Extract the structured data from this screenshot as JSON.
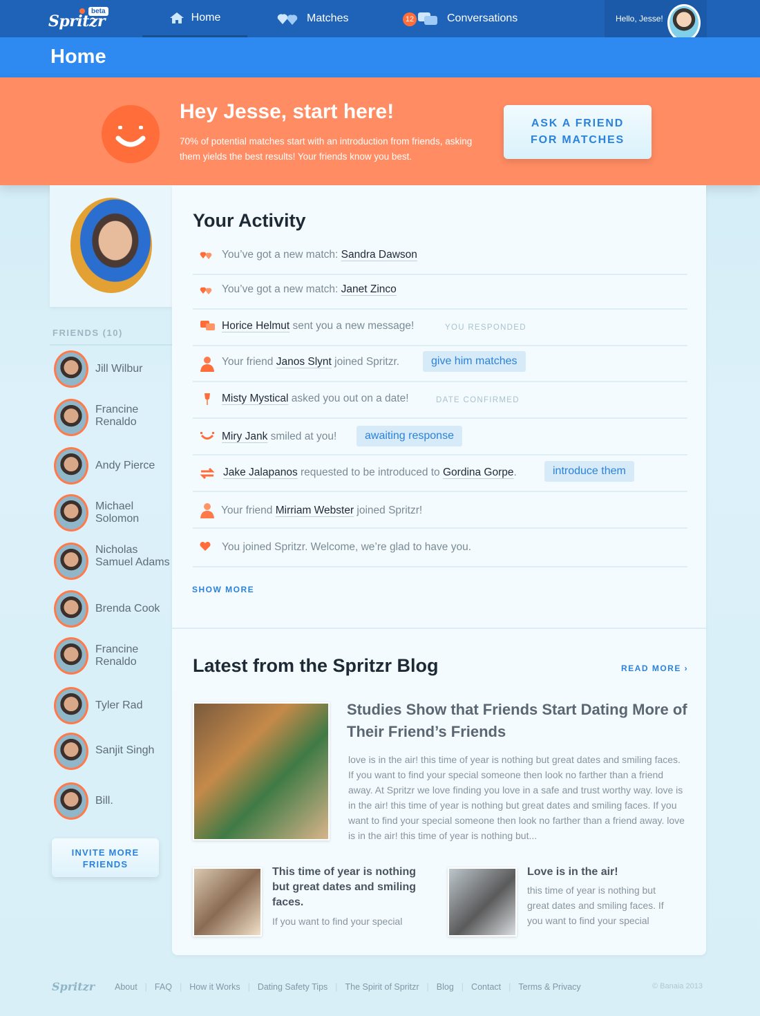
{
  "nav": {
    "logo": "Spritzr",
    "beta": "beta",
    "home": "Home",
    "matches": "Matches",
    "conversations": "Conversations",
    "conversation_count": "12",
    "greeting": "Hello, Jesse!"
  },
  "page_title": "Home",
  "hero": {
    "title": "Hey Jesse, start here!",
    "text": "70% of potential matches start with an introduction from friends, asking them yields the best results! Your friends know you best.",
    "button": "ASK A FRIEND FOR MATCHES"
  },
  "sidebar": {
    "friends_label": "FRIENDS (10)",
    "friends": [
      {
        "name": "Jill Wilbur"
      },
      {
        "name": "Francine Renaldo"
      },
      {
        "name": "Andy Pierce"
      },
      {
        "name": "Michael Solomon"
      },
      {
        "name": "Nicholas Samuel Adams"
      },
      {
        "name": "Brenda Cook"
      },
      {
        "name": "Francine Renaldo"
      },
      {
        "name": "Tyler Rad"
      },
      {
        "name": "Sanjit Singh"
      },
      {
        "name": "Bill."
      }
    ],
    "invite_button": "INVITE MORE FRIENDS"
  },
  "activity": {
    "title": "Your Activity",
    "rows": [
      {
        "pre": "You’ve got a new match: ",
        "link": "Sandra Dawson"
      },
      {
        "pre": "You’ve got a new match: ",
        "link": "Janet Zinco"
      },
      {
        "link": "Horice Helmut",
        "post": " sent you a new message!",
        "status": "YOU RESPONDED"
      },
      {
        "pre": "Your friend ",
        "link": "Janos Slynt",
        "post": " joined Spritzr.",
        "action": "give him matches"
      },
      {
        "link": "Misty Mystical",
        "post": " asked you out on a date!",
        "status": "DATE CONFIRMED"
      },
      {
        "link": "Miry Jank",
        "post": " smiled at you!",
        "action": "awaiting response"
      },
      {
        "link": "Jake Jalapanos",
        "mid": " requested to be introduced to ",
        "link2": "Gordina Gorpe",
        "post": ".",
        "action": "introduce them"
      },
      {
        "pre": "Your friend ",
        "link": "Mirriam Webster",
        "post": " joined Spritzr!"
      },
      {
        "pre": "You joined Spritzr. Welcome, we’re glad to have you."
      }
    ],
    "show_more": "SHOW MORE"
  },
  "blog": {
    "title": "Latest from the Spritzr Blog",
    "read_more": "READ MORE ›",
    "main_post": {
      "title": "Studies Show that Friends Start Dating More of Their Friend’s Friends",
      "excerpt": "love is in the air! this time of year is nothing but great dates and smiling faces. If you want to find your special someone then look no farther than a friend away. At Spritzr we love finding you love in a safe and trust worthy way. love is in the air! this time of year is nothing but great dates and smiling faces. If you want to find your special someone then look no farther than a friend away. love is in the air! this time of year is nothing but..."
    },
    "post2": {
      "title": "This time of year is nothing but great dates and smiling faces.",
      "excerpt": "If you want to find your special"
    },
    "post3": {
      "title": "Love is in the air!",
      "excerpt": "this time of year is nothing but great dates and smiling faces. If you want to find your special"
    }
  },
  "footer": {
    "logo": "Spritzr",
    "links": [
      "About",
      "FAQ",
      "How it Works",
      "Dating Safety Tips",
      "The Spirit of Spritzr",
      "Blog",
      "Contact",
      "Terms & Privacy"
    ],
    "copyright": "© Banaia 2013"
  },
  "colors": {
    "nav_bg": "#1e63b8",
    "title_bg": "#2e8af0",
    "hero_bg": "#ff8c63",
    "accent_orange": "#ff6d3a",
    "link_blue": "#2a82dc"
  }
}
